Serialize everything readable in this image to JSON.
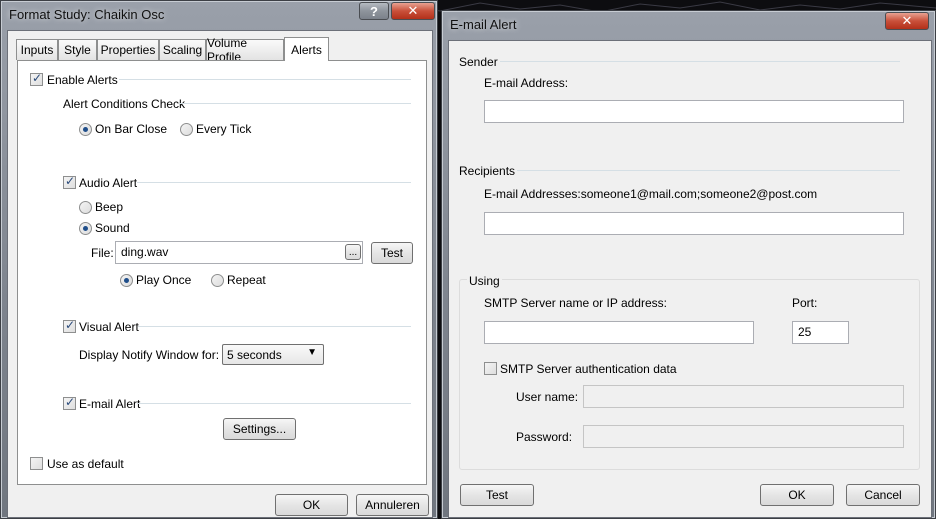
{
  "format_window": {
    "title": "Format Study: Chaikin Osc",
    "help_label": "?",
    "close_label": "✕",
    "tabs": [
      {
        "label": "Inputs"
      },
      {
        "label": "Style"
      },
      {
        "label": "Properties"
      },
      {
        "label": "Scaling"
      },
      {
        "label": "Volume Profile"
      },
      {
        "label": "Alerts",
        "active": true
      }
    ],
    "enable_alerts": {
      "label": "Enable Alerts",
      "checked": true
    },
    "conditions": {
      "heading": "Alert Conditions Check",
      "on_bar_close": {
        "label": "On Bar Close",
        "selected": true
      },
      "every_tick": {
        "label": "Every Tick",
        "selected": false
      }
    },
    "audio_alert": {
      "label": "Audio Alert",
      "checked": true
    },
    "beep": {
      "label": "Beep",
      "selected": false
    },
    "sound": {
      "label": "Sound",
      "selected": true
    },
    "file": {
      "label": "File:",
      "value": "ding.wav",
      "browse_label": "...",
      "test_label": "Test"
    },
    "play_once": {
      "label": "Play Once",
      "selected": true
    },
    "repeat": {
      "label": "Repeat",
      "selected": false
    },
    "visual_alert": {
      "label": "Visual Alert",
      "checked": true
    },
    "notify": {
      "label": "Display Notify Window for:",
      "value": "5 seconds"
    },
    "email_alert": {
      "label": "E-mail Alert",
      "checked": true
    },
    "settings_label": "Settings...",
    "use_default": {
      "label": "Use as default",
      "checked": false
    },
    "ok_label": "OK",
    "cancel_label": "Annuleren"
  },
  "email_window": {
    "title": "E-mail Alert",
    "close_label": "✕",
    "sender": {
      "heading": "Sender",
      "address_label": "E-mail Address:",
      "address_value": ""
    },
    "recipients": {
      "heading": "Recipients",
      "addresses_label": "E-mail Addresses:someone1@mail.com;someone2@post.com",
      "addresses_value": ""
    },
    "using": {
      "heading": "Using",
      "smtp_label": "SMTP Server name or IP address:",
      "smtp_value": "",
      "port_label": "Port:",
      "port_value": "25",
      "auth": {
        "label": "SMTP Server authentication data",
        "checked": false
      },
      "username_label": "User name:",
      "username_value": "",
      "password_label": "Password:",
      "password_value": ""
    },
    "test_label": "Test",
    "ok_label": "OK",
    "cancel_label": "Cancel"
  }
}
